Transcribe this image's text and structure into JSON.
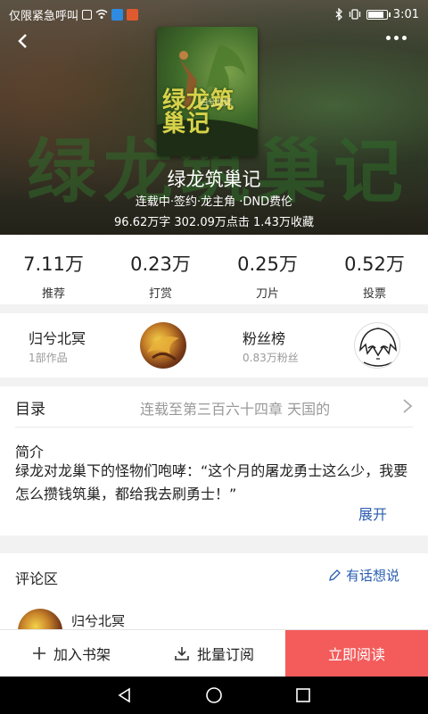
{
  "status_bar": {
    "carrier_text": "仅限紧急呼叫",
    "time": "3:01"
  },
  "book": {
    "title": "绿龙筑巢记",
    "tags": "连载中·签约·龙主角 ·DND费伦",
    "stats_line": "96.62万字 302.09万点击 1.43万收藏",
    "cover_title": "绿龙筑巢记",
    "cover_author": "归兮北冥"
  },
  "stats": [
    {
      "value": "7.11万",
      "label": "推荐"
    },
    {
      "value": "0.23万",
      "label": "打赏"
    },
    {
      "value": "0.25万",
      "label": "刀片"
    },
    {
      "value": "0.52万",
      "label": "投票"
    }
  ],
  "author": {
    "name": "归兮北冥",
    "works": "1部作品"
  },
  "fans": {
    "title": "粉丝榜",
    "count": "0.83万粉丝"
  },
  "toc": {
    "label": "目录",
    "latest": "连载至第三百六十四章 天国的"
  },
  "intro": {
    "title": "简介",
    "text": "绿龙对龙巢下的怪物们咆哮：“这个月的屠龙勇士这么少，我要怎么攒钱筑巢，都给我去刷勇士！”",
    "expand": "展开"
  },
  "comments": {
    "title": "评论区",
    "action": "有话想说",
    "first_user": "归兮北冥"
  },
  "actions": {
    "add_shelf": "加入书架",
    "batch_subscribe": "批量订阅",
    "read_now": "立即阅读"
  },
  "colors": {
    "accent_red": "#f45b5b",
    "link_blue": "#2a5db0"
  },
  "battery_level": 0.85
}
